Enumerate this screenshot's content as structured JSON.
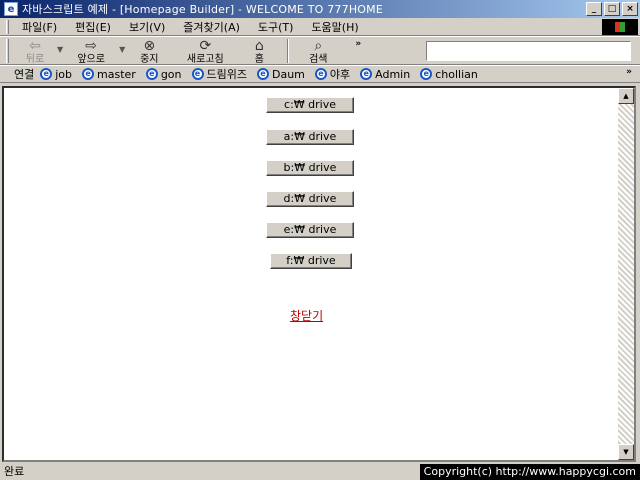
{
  "window": {
    "title": "자바스크립트 예제 - [Homepage Builder] - WELCOME TO 777HOME",
    "buttons": {
      "minimize": "_",
      "maximize": "□",
      "close": "×"
    }
  },
  "menu": {
    "items": [
      {
        "label": "파일(F)"
      },
      {
        "label": "편집(E)"
      },
      {
        "label": "보기(V)"
      },
      {
        "label": "즐겨찾기(A)"
      },
      {
        "label": "도구(T)"
      },
      {
        "label": "도움말(H)"
      }
    ]
  },
  "toolbar": {
    "back": {
      "label": "뒤로",
      "icon": "back-arrow-icon"
    },
    "forward": {
      "label": "앞으로",
      "icon": "forward-arrow-icon"
    },
    "stop": {
      "label": "중지",
      "icon": "stop-icon"
    },
    "refresh": {
      "label": "새로고침",
      "icon": "refresh-icon"
    },
    "home": {
      "label": "홈",
      "icon": "home-icon"
    },
    "search": {
      "label": "검색",
      "icon": "search-icon"
    },
    "more": "»",
    "address_value": ""
  },
  "links": {
    "label": "연결",
    "items": [
      {
        "label": "job"
      },
      {
        "label": "master"
      },
      {
        "label": "gon"
      },
      {
        "label": "드림위즈"
      },
      {
        "label": "Daum"
      },
      {
        "label": "야후"
      },
      {
        "label": "Admin"
      },
      {
        "label": "chollian"
      }
    ],
    "more": "»"
  },
  "content": {
    "drives": [
      {
        "label": "c:₩ drive"
      },
      {
        "label": "a:₩ drive"
      },
      {
        "label": "b:₩ drive"
      },
      {
        "label": "d:₩ drive"
      },
      {
        "label": "e:₩ drive"
      },
      {
        "label": "f:₩ drive"
      }
    ],
    "close_link": "창닫기"
  },
  "status": {
    "text": "완료",
    "copyright": "Copyright(c) http://www.happycgi.com"
  }
}
